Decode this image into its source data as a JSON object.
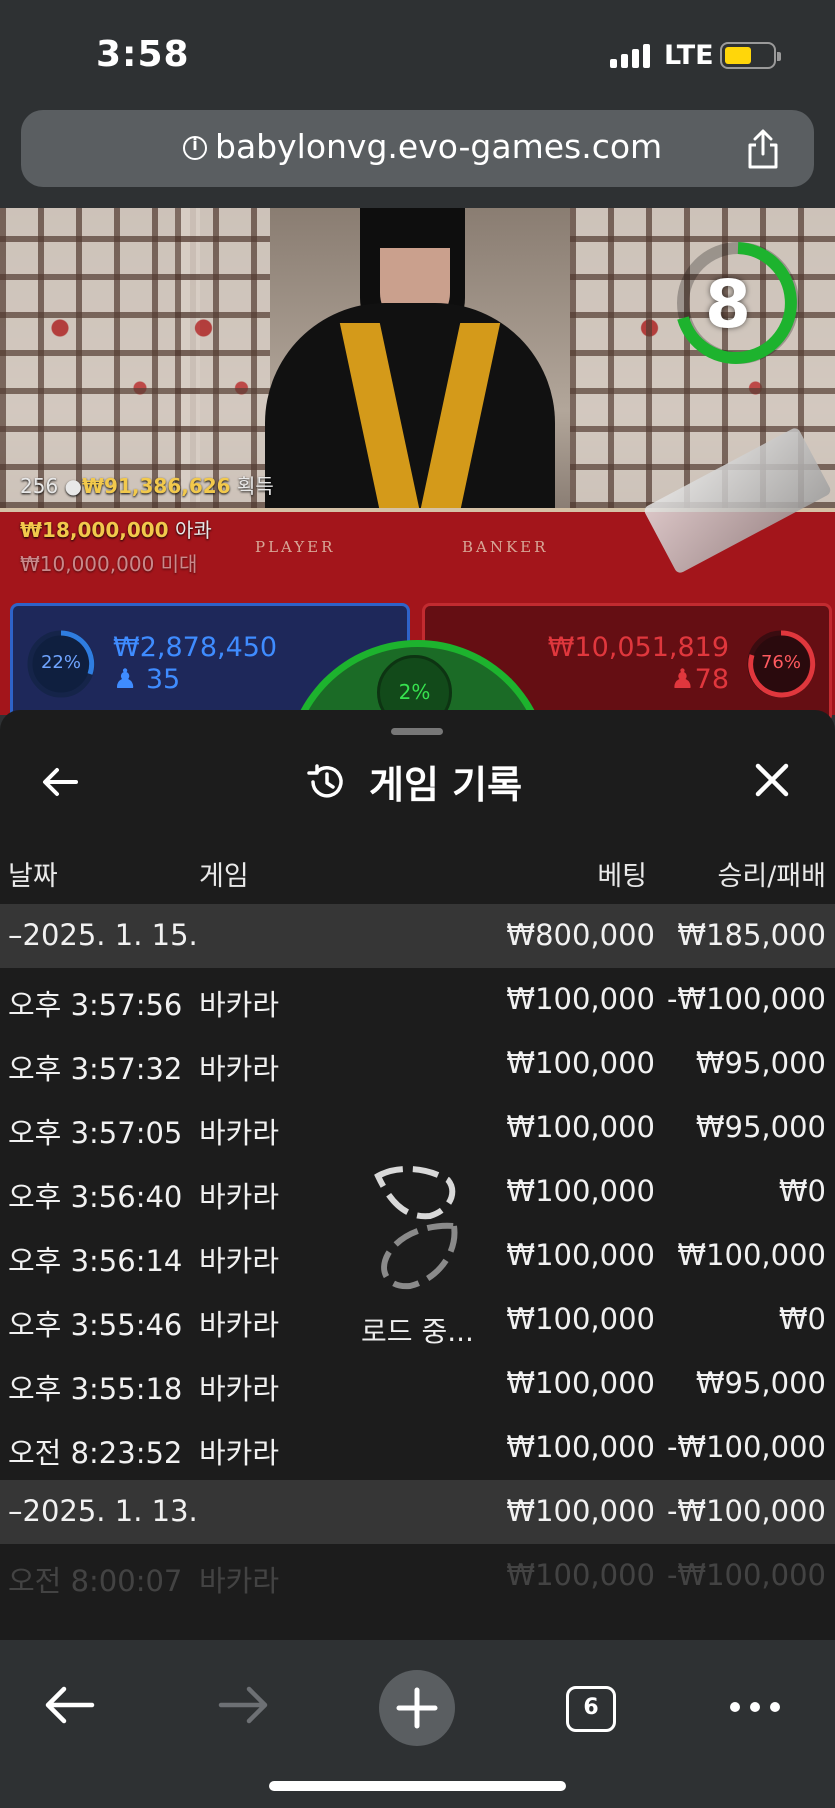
{
  "status_bar": {
    "time": "3:58",
    "network": "LTE"
  },
  "browser": {
    "url": "babylonvg.evo-games.com",
    "tab_count": "6"
  },
  "video": {
    "timer": "8",
    "felt_player": "PLAYER",
    "felt_banker": "BANKER",
    "stats": {
      "line1_count": "256",
      "line1_amount": "₩91,386,626",
      "line1_label": "획득",
      "line2_amount": "₩18,000,000",
      "line2_label": "아콰",
      "line3_amount": "₩10,000,000",
      "line3_label": "미대"
    },
    "player": {
      "percent": "22%",
      "amount": "₩2,878,450",
      "count": "35"
    },
    "banker": {
      "percent": "76%",
      "amount": "₩10,051,819",
      "count": "78"
    },
    "tie": {
      "percent": "2%"
    }
  },
  "sheet": {
    "title": "게임 기록",
    "columns": {
      "date": "날짜",
      "game": "게임",
      "bet": "베팅",
      "win_loss": "승리/패배"
    },
    "loading_text": "로드 중...",
    "groups": [
      {
        "date": "–2025. 1. 15.",
        "total_bet": "₩800,000",
        "total_win": "₩185,000",
        "rows": [
          {
            "time": "오후 3:57:56",
            "game": "바카라",
            "bet": "₩100,000",
            "win": "-₩100,000"
          },
          {
            "time": "오후 3:57:32",
            "game": "바카라",
            "bet": "₩100,000",
            "win": "₩95,000"
          },
          {
            "time": "오후 3:57:05",
            "game": "바카라",
            "bet": "₩100,000",
            "win": "₩95,000"
          },
          {
            "time": "오후 3:56:40",
            "game": "바카라",
            "bet": "₩100,000",
            "win": "₩0"
          },
          {
            "time": "오후 3:56:14",
            "game": "바카라",
            "bet": "₩100,000",
            "win": "₩100,000"
          },
          {
            "time": "오후 3:55:46",
            "game": "바카라",
            "bet": "₩100,000",
            "win": "₩0"
          },
          {
            "time": "오후 3:55:18",
            "game": "바카라",
            "bet": "₩100,000",
            "win": "₩95,000"
          },
          {
            "time": "오전 8:23:52",
            "game": "바카라",
            "bet": "₩100,000",
            "win": "-₩100,000"
          }
        ]
      },
      {
        "date": "–2025. 1. 13.",
        "total_bet": "₩100,000",
        "total_win": "-₩100,000",
        "rows": [
          {
            "time": "오전 8:00:07",
            "game": "바카라",
            "bet": "₩100,000",
            "win": "-₩100,000"
          }
        ]
      }
    ]
  },
  "colors": {
    "player_blue": "#2f63c9",
    "banker_red": "#c22b30",
    "tie_green": "#1db32e",
    "gold": "#f2c94c",
    "battery_yellow": "#ffd60a"
  },
  "icons": {
    "back": "arrow-left-icon",
    "history": "history-clock-icon",
    "close": "close-icon",
    "spinner": "loading-spinner-icon",
    "share": "share-icon",
    "info": "info-icon",
    "browser_back": "browser-back-icon",
    "browser_forward": "browser-forward-icon",
    "new_tab": "plus-icon",
    "more": "more-icon"
  }
}
